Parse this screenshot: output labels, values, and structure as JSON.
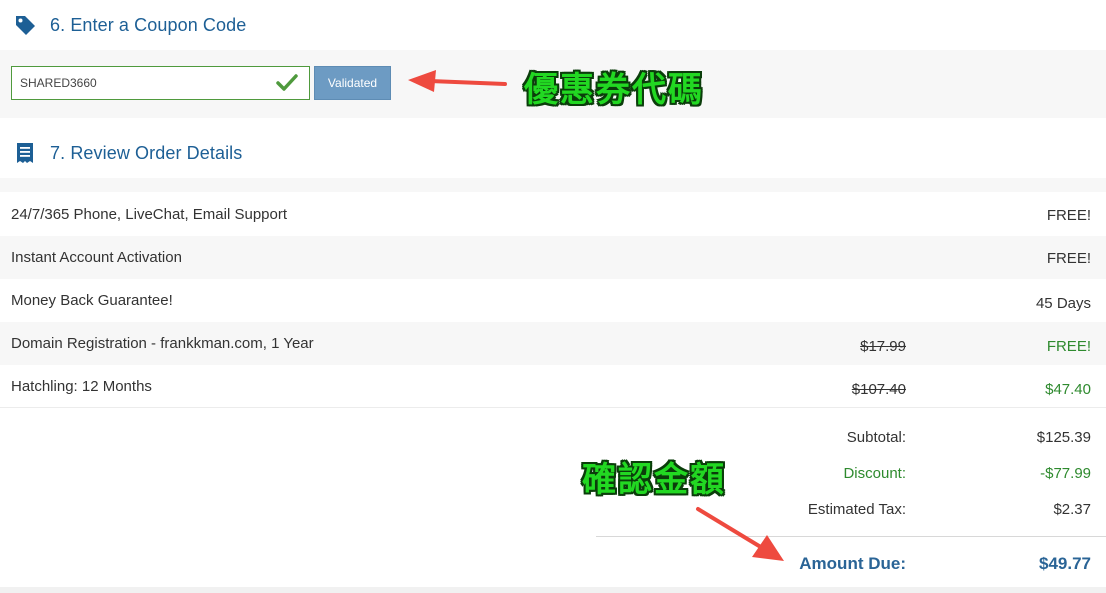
{
  "coupon_section": {
    "title": "6. Enter a Coupon Code",
    "input_value": "SHARED3660",
    "button_label": "Validated"
  },
  "review_section": {
    "title": "7. Review Order Details",
    "items": [
      {
        "description": "24/7/365 Phone, LiveChat, Email Support",
        "old_price": "",
        "price": "FREE!"
      },
      {
        "description": "Instant Account Activation",
        "old_price": "",
        "price": "FREE!"
      },
      {
        "description": "Money Back Guarantee!",
        "old_price": "",
        "price": "45 Days"
      },
      {
        "description": "Domain Registration - frankkman.com, 1 Year",
        "old_price": "$17.99",
        "price": "FREE!"
      },
      {
        "description": "Hatchling: 12 Months",
        "old_price": "$107.40",
        "price": "$47.40"
      }
    ]
  },
  "summary": {
    "subtotal_label": "Subtotal:",
    "subtotal_value": "$125.39",
    "discount_label": "Discount:",
    "discount_value": "-$77.99",
    "tax_label": "Estimated Tax:",
    "tax_value": "$2.37",
    "due_label": "Amount Due:",
    "due_value": "$49.77"
  },
  "annotations": {
    "coupon_note": "優惠券代碼",
    "amount_note": "確認金額"
  },
  "colors": {
    "heading_blue": "#1d5f95",
    "success_green": "#2e8a2e",
    "button_blue": "#6d9bc3",
    "annotation_green": "#22d822",
    "arrow_red": "#ee4a3f"
  },
  "icons": {
    "coupon": "tag-icon",
    "review": "receipt-icon",
    "validated": "checkmark-icon"
  }
}
